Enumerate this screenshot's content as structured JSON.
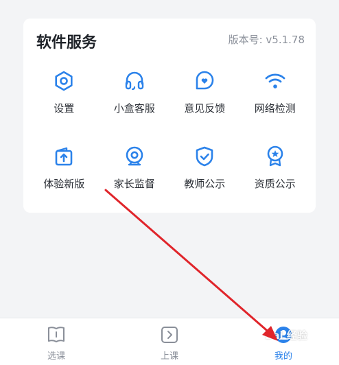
{
  "card": {
    "title": "软件服务",
    "version": "版本号: v5.1.78"
  },
  "items": [
    {
      "label": "设置",
      "icon": "gear-icon"
    },
    {
      "label": "小盒客服",
      "icon": "headset-icon"
    },
    {
      "label": "意见反馈",
      "icon": "feedback-heart-icon"
    },
    {
      "label": "网络检测",
      "icon": "wifi-icon"
    },
    {
      "label": "体验新版",
      "icon": "upgrade-icon"
    },
    {
      "label": "家长监督",
      "icon": "camera-icon"
    },
    {
      "label": "教师公示",
      "icon": "shield-check-icon"
    },
    {
      "label": "资质公示",
      "icon": "award-medal-icon"
    }
  ],
  "tabbar": {
    "tabs": [
      {
        "label": "选课",
        "icon": "book-icon"
      },
      {
        "label": "上课",
        "icon": "play-next-icon"
      },
      {
        "label": "我的",
        "icon": "profile-icon",
        "active": true
      }
    ]
  },
  "watermark": "Bai 经验",
  "colors": {
    "accent": "#2b82ea",
    "annotation_arrow": "#e0252b"
  }
}
